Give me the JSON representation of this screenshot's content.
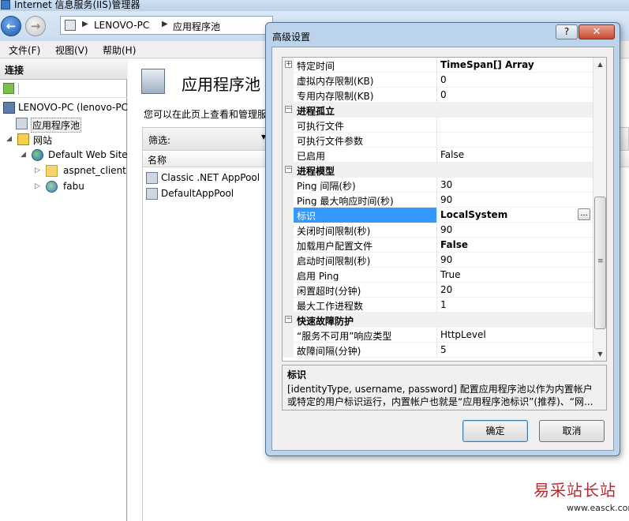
{
  "window": {
    "title": "Internet 信息服务(IIS)管理器"
  },
  "address_bar": {
    "parts": [
      "LENOVO-PC",
      "应用程序池"
    ]
  },
  "menu": {
    "items": [
      "文件(F)",
      "视图(V)",
      "帮助(H)"
    ]
  },
  "connections": {
    "header": "连接",
    "tree": [
      {
        "label": "LENOVO-PC (lenovo-PC",
        "icon": "server-icon"
      },
      {
        "label": "应用程序池",
        "icon": "app-pool-icon"
      },
      {
        "label": "网站",
        "icon": "sites-icon"
      },
      {
        "label": "Default Web Site",
        "icon": "globe-icon"
      },
      {
        "label": "aspnet_client",
        "icon": "folder-icon"
      },
      {
        "label": "fabu",
        "icon": "app-icon"
      }
    ]
  },
  "main": {
    "title": "应用程序池",
    "description": "您可以在此页上查看和管理服",
    "filter_label": "筛选:",
    "column_header": "名称",
    "pools": [
      "Classic .NET AppPool",
      "DefaultAppPool"
    ]
  },
  "dialog": {
    "title": "高级设置",
    "help_label": "?",
    "close_label": "✕",
    "properties": [
      {
        "type": "prop",
        "name": "特定时间",
        "value": "TimeSpan[] Array",
        "bold": true,
        "expander": "+"
      },
      {
        "type": "prop",
        "name": "虚拟内存限制(KB)",
        "value": "0"
      },
      {
        "type": "prop",
        "name": "专用内存限制(KB)",
        "value": "0"
      },
      {
        "type": "category",
        "name": "进程孤立",
        "toggle": "−"
      },
      {
        "type": "prop",
        "name": "可执行文件",
        "value": ""
      },
      {
        "type": "prop",
        "name": "可执行文件参数",
        "value": ""
      },
      {
        "type": "prop",
        "name": "已启用",
        "value": "False"
      },
      {
        "type": "category",
        "name": "进程模型",
        "toggle": "−"
      },
      {
        "type": "prop",
        "name": "Ping 间隔(秒)",
        "value": "30"
      },
      {
        "type": "prop",
        "name": "Ping 最大响应时间(秒)",
        "value": "90"
      },
      {
        "type": "prop",
        "name": "标识",
        "value": "LocalSystem",
        "bold": true,
        "selected": true,
        "button": "..."
      },
      {
        "type": "prop",
        "name": "关闭时间限制(秒)",
        "value": "90"
      },
      {
        "type": "prop",
        "name": "加载用户配置文件",
        "value": "False",
        "bold": true
      },
      {
        "type": "prop",
        "name": "启动时间限制(秒)",
        "value": "90"
      },
      {
        "type": "prop",
        "name": "启用 Ping",
        "value": "True"
      },
      {
        "type": "prop",
        "name": "闲置超时(分钟)",
        "value": "20"
      },
      {
        "type": "prop",
        "name": "最大工作进程数",
        "value": "1"
      },
      {
        "type": "category",
        "name": "快速故障防护",
        "toggle": "−"
      },
      {
        "type": "prop",
        "name": "“服务不可用”响应类型",
        "value": "HttpLevel"
      },
      {
        "type": "prop",
        "name": "故障间隔(分钟)",
        "value": "5"
      }
    ],
    "description_title": "标识",
    "description_text": "[identityType, username, password] 配置应用程序池以作为内置帐户或特定的用户标识运行，内置帐户也就是“应用程序池标识”(推荐)、“网...",
    "ok_label": "确定",
    "cancel_label": "取消"
  },
  "watermark": {
    "main": "易采站长站",
    "sub": "www.easck.com"
  }
}
